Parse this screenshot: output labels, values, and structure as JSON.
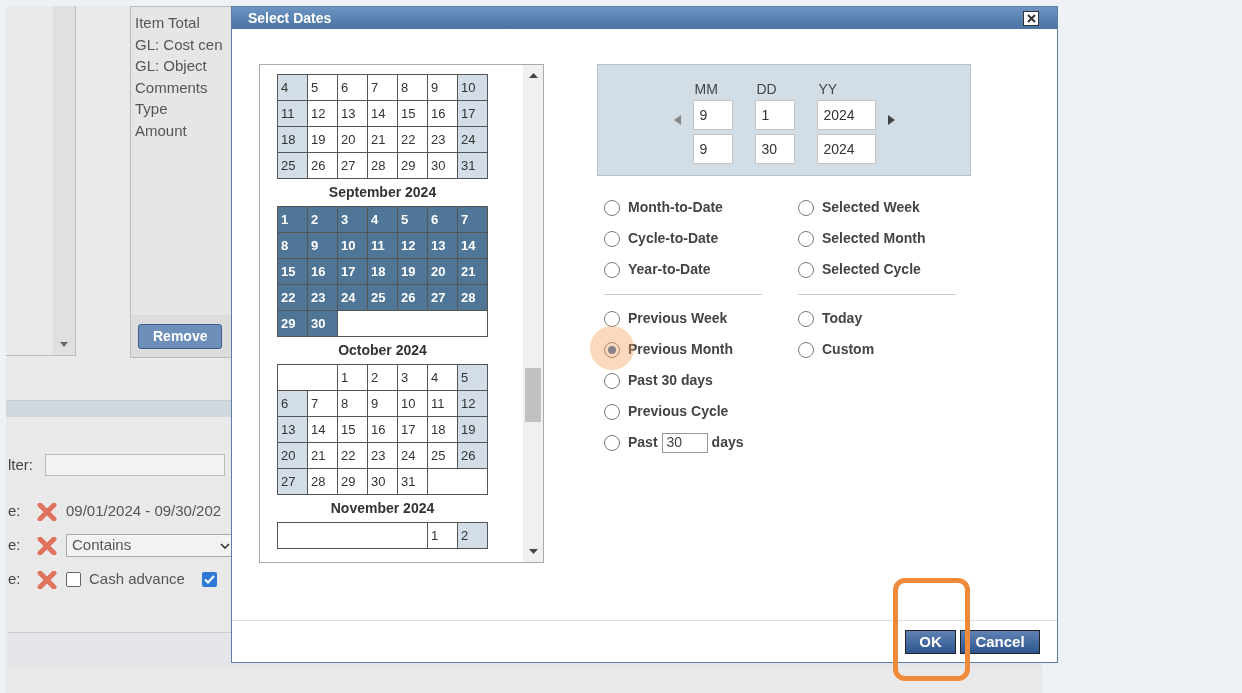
{
  "background": {
    "field_list": [
      "Item Total",
      "GL: Cost cen",
      "GL: Object",
      "Comments",
      "Type",
      "Amount"
    ],
    "remove_button": "Remove",
    "filter_label": "lter:",
    "criteria": [
      {
        "kind": "text",
        "label": "e:",
        "value": "09/01/2024 - 09/30/202"
      },
      {
        "kind": "select",
        "label": "e:",
        "value": "Contains"
      },
      {
        "kind": "checks",
        "label": "e:",
        "options": [
          {
            "label": "Cash advance",
            "checked": false
          },
          {
            "checked": true
          }
        ]
      }
    ]
  },
  "dialog": {
    "title": "Select Dates",
    "calendar": [
      {
        "weeks": [
          [
            {
              "kind": "day",
              "day": "4",
              "selected": false
            },
            {
              "kind": "day",
              "day": "5",
              "selected": false
            },
            {
              "kind": "day",
              "day": "6",
              "selected": false
            },
            {
              "kind": "day",
              "day": "7",
              "selected": false
            },
            {
              "kind": "day",
              "day": "8",
              "selected": false
            },
            {
              "kind": "day",
              "day": "9",
              "selected": false
            },
            {
              "kind": "day",
              "day": "10",
              "selected": false
            }
          ],
          [
            {
              "kind": "day",
              "day": "11",
              "selected": false
            },
            {
              "kind": "day",
              "day": "12",
              "selected": false
            },
            {
              "kind": "day",
              "day": "13",
              "selected": false
            },
            {
              "kind": "day",
              "day": "14",
              "selected": false
            },
            {
              "kind": "day",
              "day": "15",
              "selected": false
            },
            {
              "kind": "day",
              "day": "16",
              "selected": false
            },
            {
              "kind": "day",
              "day": "17",
              "selected": false
            }
          ],
          [
            {
              "kind": "day",
              "day": "18",
              "selected": false
            },
            {
              "kind": "day",
              "day": "19",
              "selected": false
            },
            {
              "kind": "day",
              "day": "20",
              "selected": false
            },
            {
              "kind": "day",
              "day": "21",
              "selected": false
            },
            {
              "kind": "day",
              "day": "22",
              "selected": false
            },
            {
              "kind": "day",
              "day": "23",
              "selected": false
            },
            {
              "kind": "day",
              "day": "24",
              "selected": false
            }
          ],
          [
            {
              "kind": "day",
              "day": "25",
              "selected": false
            },
            {
              "kind": "day",
              "day": "26",
              "selected": false
            },
            {
              "kind": "day",
              "day": "27",
              "selected": false
            },
            {
              "kind": "day",
              "day": "28",
              "selected": false
            },
            {
              "kind": "day",
              "day": "29",
              "selected": false
            },
            {
              "kind": "day",
              "day": "30",
              "selected": false
            },
            {
              "kind": "day",
              "day": "31",
              "selected": false
            }
          ]
        ]
      },
      {
        "title": "September 2024",
        "weeks": [
          [
            {
              "kind": "day",
              "day": "1",
              "selected": true
            },
            {
              "kind": "day",
              "day": "2",
              "selected": true
            },
            {
              "kind": "day",
              "day": "3",
              "selected": true
            },
            {
              "kind": "day",
              "day": "4",
              "selected": true
            },
            {
              "kind": "day",
              "day": "5",
              "selected": true
            },
            {
              "kind": "day",
              "day": "6",
              "selected": true
            },
            {
              "kind": "day",
              "day": "7",
              "selected": true
            }
          ],
          [
            {
              "kind": "day",
              "day": "8",
              "selected": true
            },
            {
              "kind": "day",
              "day": "9",
              "selected": true
            },
            {
              "kind": "day",
              "day": "10",
              "selected": true
            },
            {
              "kind": "day",
              "day": "11",
              "selected": true
            },
            {
              "kind": "day",
              "day": "12",
              "selected": true
            },
            {
              "kind": "day",
              "day": "13",
              "selected": true
            },
            {
              "kind": "day",
              "day": "14",
              "selected": true
            }
          ],
          [
            {
              "kind": "day",
              "day": "15",
              "selected": true
            },
            {
              "kind": "day",
              "day": "16",
              "selected": true
            },
            {
              "kind": "day",
              "day": "17",
              "selected": true
            },
            {
              "kind": "day",
              "day": "18",
              "selected": true
            },
            {
              "kind": "day",
              "day": "19",
              "selected": true
            },
            {
              "kind": "day",
              "day": "20",
              "selected": true
            },
            {
              "kind": "day",
              "day": "21",
              "selected": true
            }
          ],
          [
            {
              "kind": "day",
              "day": "22",
              "selected": true
            },
            {
              "kind": "day",
              "day": "23",
              "selected": true
            },
            {
              "kind": "day",
              "day": "24",
              "selected": true
            },
            {
              "kind": "day",
              "day": "25",
              "selected": true
            },
            {
              "kind": "day",
              "day": "26",
              "selected": true
            },
            {
              "kind": "day",
              "day": "27",
              "selected": true
            },
            {
              "kind": "day",
              "day": "28",
              "selected": true
            }
          ],
          [
            {
              "kind": "day",
              "day": "29",
              "selected": true
            },
            {
              "kind": "day",
              "day": "30",
              "selected": true
            },
            {
              "kind": "blank"
            },
            {
              "kind": "blank"
            },
            {
              "kind": "blank"
            },
            {
              "kind": "blank"
            },
            {
              "kind": "blank"
            }
          ]
        ]
      },
      {
        "title": "October 2024",
        "weeks": [
          [
            {
              "kind": "blank"
            },
            {
              "kind": "blank"
            },
            {
              "kind": "day",
              "day": "1",
              "selected": false
            },
            {
              "kind": "day",
              "day": "2",
              "selected": false
            },
            {
              "kind": "day",
              "day": "3",
              "selected": false
            },
            {
              "kind": "day",
              "day": "4",
              "selected": false
            },
            {
              "kind": "day",
              "day": "5",
              "selected": false
            }
          ],
          [
            {
              "kind": "day",
              "day": "6",
              "selected": false
            },
            {
              "kind": "day",
              "day": "7",
              "selected": false
            },
            {
              "kind": "day",
              "day": "8",
              "selected": false
            },
            {
              "kind": "day",
              "day": "9",
              "selected": false
            },
            {
              "kind": "day",
              "day": "10",
              "selected": false
            },
            {
              "kind": "day",
              "day": "11",
              "selected": false
            },
            {
              "kind": "day",
              "day": "12",
              "selected": false
            }
          ],
          [
            {
              "kind": "day",
              "day": "13",
              "selected": false
            },
            {
              "kind": "day",
              "day": "14",
              "selected": false
            },
            {
              "kind": "day",
              "day": "15",
              "selected": false
            },
            {
              "kind": "day",
              "day": "16",
              "selected": false
            },
            {
              "kind": "day",
              "day": "17",
              "selected": false
            },
            {
              "kind": "day",
              "day": "18",
              "selected": false
            },
            {
              "kind": "day",
              "day": "19",
              "selected": false
            }
          ],
          [
            {
              "kind": "day",
              "day": "20",
              "selected": false
            },
            {
              "kind": "day",
              "day": "21",
              "selected": false
            },
            {
              "kind": "day",
              "day": "22",
              "selected": false
            },
            {
              "kind": "day",
              "day": "23",
              "selected": false
            },
            {
              "kind": "day",
              "day": "24",
              "selected": false
            },
            {
              "kind": "day",
              "day": "25",
              "selected": false
            },
            {
              "kind": "day",
              "day": "26",
              "selected": false
            }
          ],
          [
            {
              "kind": "day",
              "day": "27",
              "selected": false
            },
            {
              "kind": "day",
              "day": "28",
              "selected": false
            },
            {
              "kind": "day",
              "day": "29",
              "selected": false
            },
            {
              "kind": "day",
              "day": "30",
              "selected": false
            },
            {
              "kind": "day",
              "day": "31",
              "selected": false
            },
            {
              "kind": "blank"
            },
            {
              "kind": "blank"
            }
          ]
        ]
      },
      {
        "title": "November 2024",
        "weeks": [
          [
            {
              "kind": "blank"
            },
            {
              "kind": "blank"
            },
            {
              "kind": "blank"
            },
            {
              "kind": "blank"
            },
            {
              "kind": "blank"
            },
            {
              "kind": "day",
              "day": "1",
              "selected": false
            },
            {
              "kind": "day",
              "day": "2",
              "selected": false
            }
          ]
        ]
      }
    ],
    "date_headers": [
      "MM",
      "DD",
      "YY"
    ],
    "date_rows": [
      [
        "9",
        "1",
        "2024"
      ],
      [
        "9",
        "30",
        "2024"
      ]
    ],
    "option_columns": [
      [
        [
          {
            "kind": "plain",
            "label": "Month-to-Date",
            "selected": false
          },
          {
            "kind": "plain",
            "label": "Cycle-to-Date",
            "selected": false
          },
          {
            "kind": "plain",
            "label": "Year-to-Date",
            "selected": false
          }
        ],
        [
          {
            "kind": "plain",
            "label": "Previous Week",
            "selected": false
          },
          {
            "kind": "plain",
            "label": "Previous Month",
            "selected": true
          },
          {
            "kind": "plain",
            "label": "Past 30 days",
            "selected": false
          },
          {
            "kind": "plain",
            "label": "Previous Cycle",
            "selected": false
          },
          {
            "kind": "input",
            "label": "Past",
            "value": "30",
            "suffix": "days",
            "selected": false
          }
        ]
      ],
      [
        [
          {
            "kind": "plain",
            "label": "Selected Week",
            "selected": false
          },
          {
            "kind": "plain",
            "label": "Selected Month",
            "selected": false
          },
          {
            "kind": "plain",
            "label": "Selected Cycle",
            "selected": false
          }
        ],
        [
          {
            "kind": "plain",
            "label": "Today",
            "selected": false
          },
          {
            "kind": "plain",
            "label": "Custom",
            "selected": false
          }
        ]
      ]
    ],
    "buttons": [
      "OK",
      "Cancel"
    ]
  }
}
